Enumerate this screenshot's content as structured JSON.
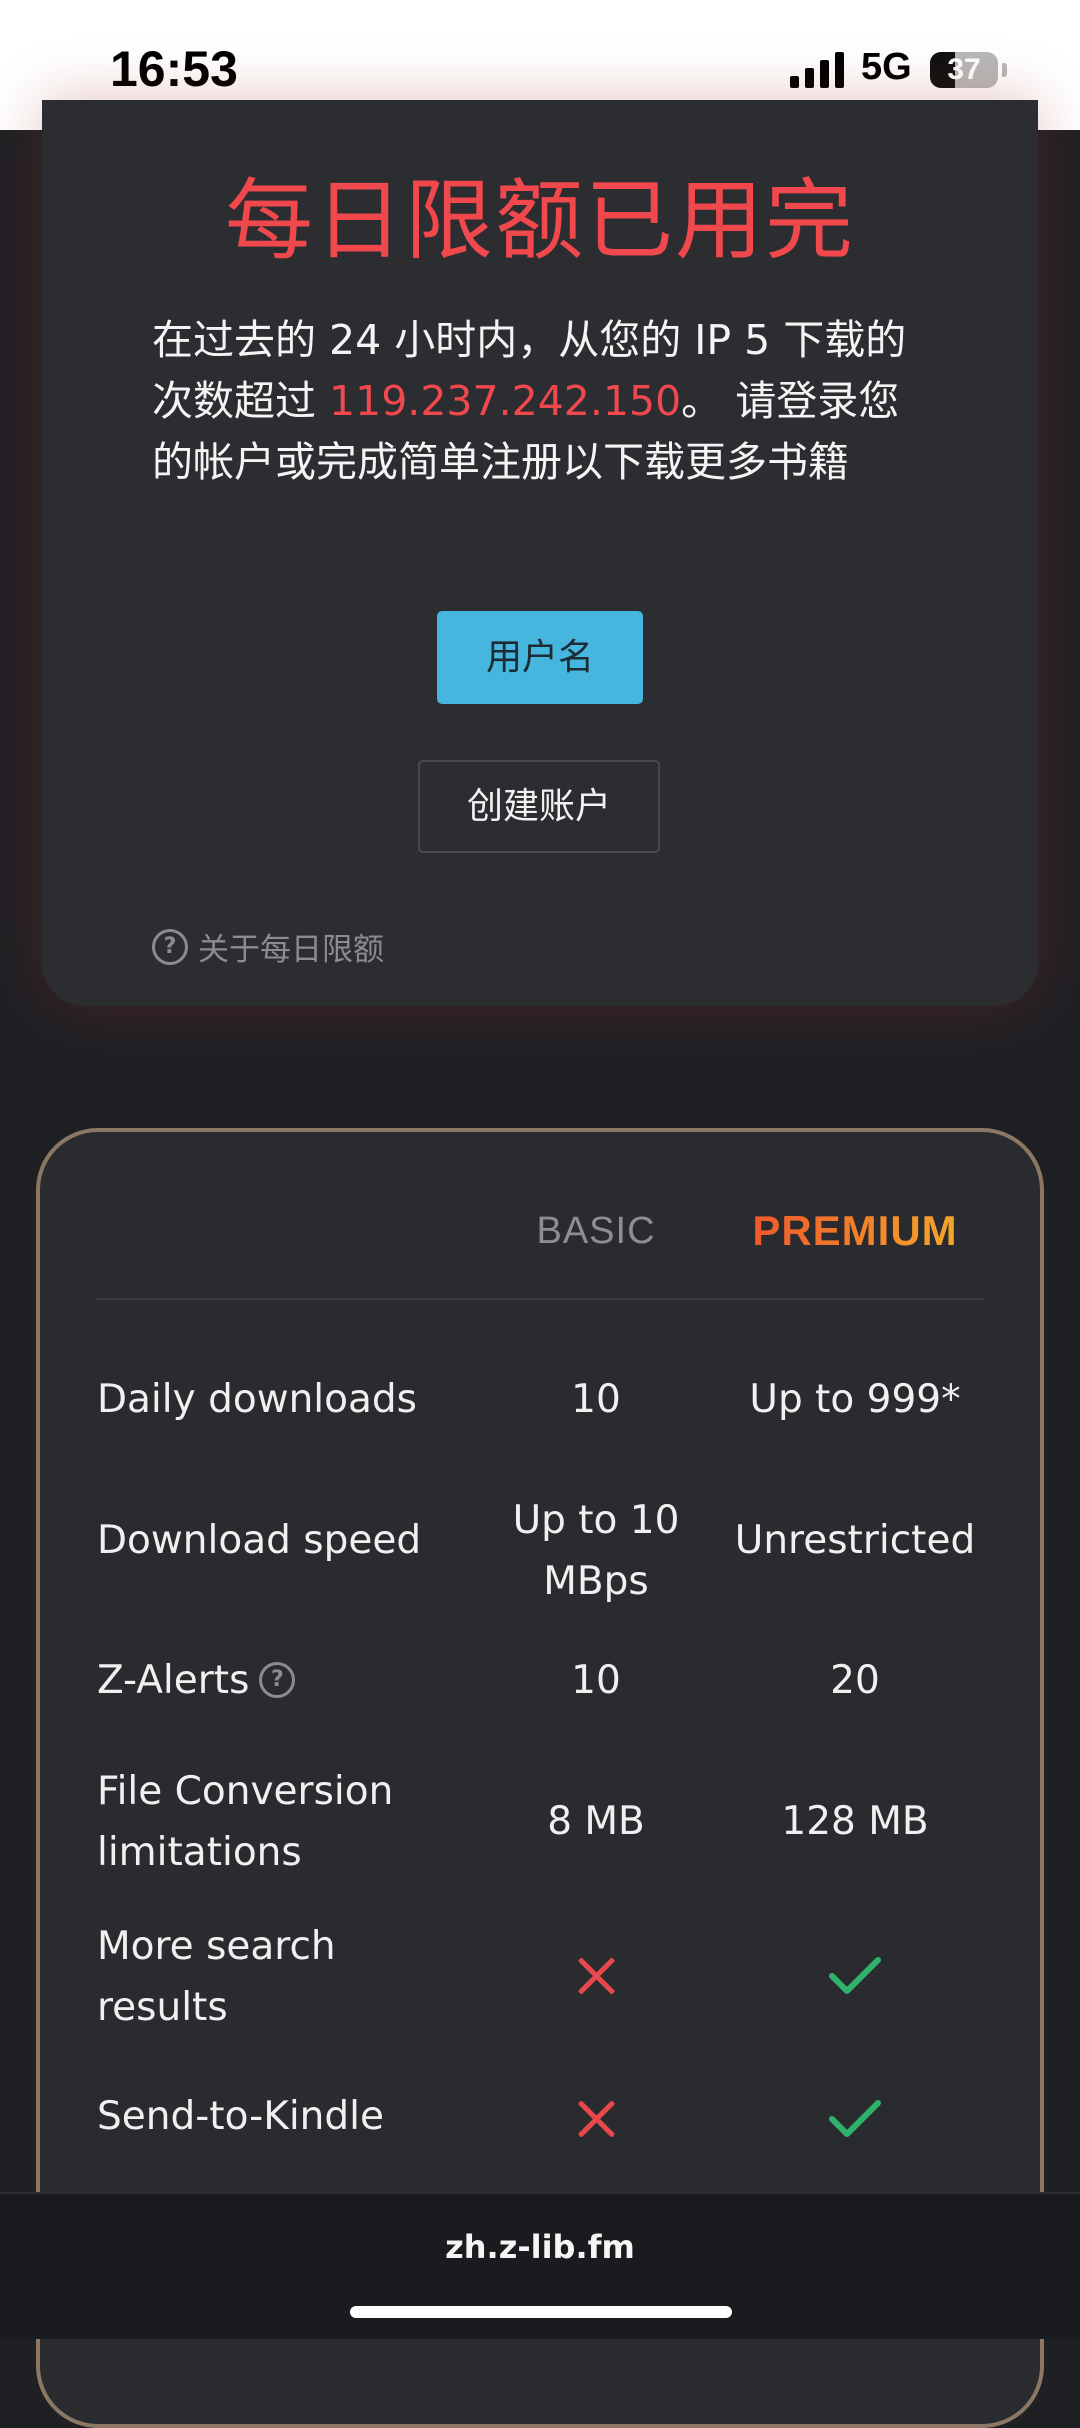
{
  "status_bar": {
    "time": "16:53",
    "network": "5G",
    "battery": "37",
    "battery_level": 0.37
  },
  "limit_notice": {
    "title": "每日限额已用完",
    "message_before": "在过去的 24 小时内，从您的 IP 5 下载的次数超过 ",
    "ip": "119.237.242.150",
    "message_after": "。 请登录您的帐户或完成简单注册以下载更多书籍",
    "login_button": "用户名",
    "create_account_button": "创建账户",
    "about_link": "关于每日限额"
  },
  "plans": {
    "basic_label": "BASIC",
    "premium_label": "PREMIUM",
    "rows": [
      {
        "feature": "Daily downloads",
        "basic": "10",
        "premium": "Up to 999*"
      },
      {
        "feature": "Download speed",
        "basic": "Up to 10 MBps",
        "premium": "Unrestricted"
      },
      {
        "feature": "Z-Alerts",
        "basic": "10",
        "premium": "20"
      },
      {
        "feature": "File Conversion limitations",
        "basic": "8 MB",
        "premium": "128 MB"
      },
      {
        "feature": "More search results",
        "basic": "no",
        "premium": "yes"
      },
      {
        "feature": "Send-to-Kindle",
        "basic": "no",
        "premium": "yes"
      }
    ]
  },
  "browser": {
    "url": "zh.z-lib.fm"
  },
  "colors": {
    "accent_red": "#f0484c",
    "button_blue": "#46b6de",
    "check_green": "#2fb36a",
    "premium_gradient_start": "#ee4b2b",
    "premium_gradient_end": "#f4b32a"
  }
}
